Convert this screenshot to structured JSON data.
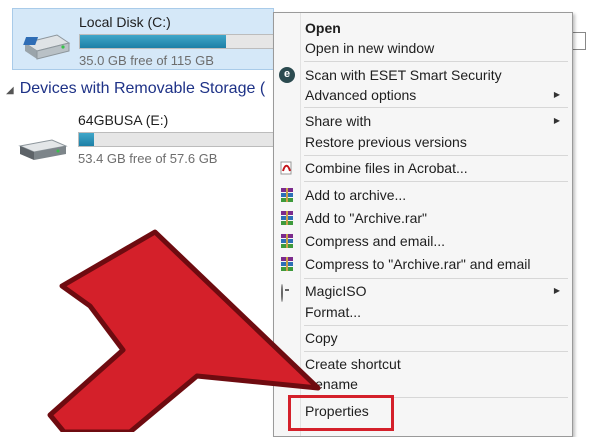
{
  "explorer": {
    "drives": [
      {
        "name": "Local Disk (C:)",
        "free_text": "35.0 GB free of 115 GB",
        "used_fraction": 0.7
      },
      {
        "name": "64GBUSA (E:)",
        "free_text": "53.4 GB free of 57.6 GB",
        "used_fraction": 0.07
      }
    ],
    "section_header": "Devices with Removable Storage ("
  },
  "context_menu": {
    "items": [
      {
        "label": "Open",
        "icon": null
      },
      {
        "label": "Open in new window",
        "icon": null
      },
      {
        "label": "Scan with ESET Smart Security",
        "icon": "eset-icon"
      },
      {
        "label": "Advanced options",
        "icon": null,
        "submenu": true
      },
      {
        "label": "Share with",
        "icon": null,
        "submenu": true
      },
      {
        "label": "Restore previous versions",
        "icon": null
      },
      {
        "label": "Combine files in Acrobat...",
        "icon": "acrobat-icon"
      },
      {
        "label": "Add to archive...",
        "icon": "winrar-icon"
      },
      {
        "label": "Add to \"Archive.rar\"",
        "icon": "winrar-icon"
      },
      {
        "label": "Compress and email...",
        "icon": "winrar-icon"
      },
      {
        "label": "Compress to \"Archive.rar\" and email",
        "icon": "winrar-icon"
      },
      {
        "label": "MagicISO",
        "icon": "magiciso-icon",
        "submenu": true
      },
      {
        "label": "Format...",
        "icon": null
      },
      {
        "label": "Copy",
        "icon": null
      },
      {
        "label": "Create shortcut",
        "icon": null
      },
      {
        "label": "Rename",
        "icon": null
      },
      {
        "label": "Properties",
        "icon": null,
        "highlighted": true
      }
    ]
  },
  "annotation": {
    "arrow_color": "#d4202a",
    "highlight_color": "#d4202a"
  }
}
